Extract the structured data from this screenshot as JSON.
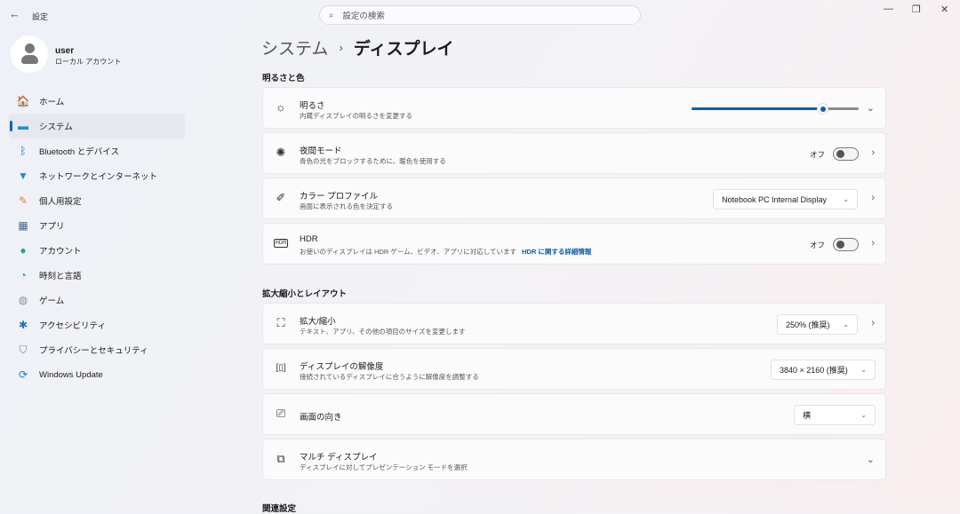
{
  "window": {
    "title": "設定",
    "back": "←",
    "minimize": "—",
    "maximize": "❐",
    "close": "✕"
  },
  "search": {
    "placeholder": "設定の検索",
    "icon": "⌕"
  },
  "user": {
    "name": "user",
    "type": "ローカル アカウント"
  },
  "nav": [
    {
      "label": "ホーム",
      "icon": "🏠",
      "color": "#e08a3c"
    },
    {
      "label": "システム",
      "icon": "▬",
      "color": "#1a8fd6"
    },
    {
      "label": "Bluetooth とデバイス",
      "icon": "ᛒ",
      "color": "#1677d2"
    },
    {
      "label": "ネットワークとインターネット",
      "icon": "▼",
      "color": "#1a8fd6"
    },
    {
      "label": "個人用設定",
      "icon": "✎",
      "color": "#d08a3c"
    },
    {
      "label": "アプリ",
      "icon": "▦",
      "color": "#4a6a8a"
    },
    {
      "label": "アカウント",
      "icon": "●",
      "color": "#2aa58a"
    },
    {
      "label": "時刻と言語",
      "icon": "◔",
      "color": "#1a8fd6"
    },
    {
      "label": "ゲーム",
      "icon": "◍",
      "color": "#8a8f98"
    },
    {
      "label": "アクセシビリティ",
      "icon": "✱",
      "color": "#1677d2"
    },
    {
      "label": "プライバシーとセキュリティ",
      "icon": "⛉",
      "color": "#7a8088"
    },
    {
      "label": "Windows Update",
      "icon": "⟳",
      "color": "#1677d2"
    }
  ],
  "breadcrumb": {
    "parent": "システム",
    "sep": "›",
    "current": "ディスプレイ"
  },
  "sections": {
    "brightness_color": "明るさと色",
    "scale_layout": "拡大縮小とレイアウト",
    "related": "関連設定"
  },
  "brightness": {
    "title": "明るさ",
    "desc": "内蔵ディスプレイの明るさを変更する",
    "value": 78,
    "icon": "☼"
  },
  "night": {
    "title": "夜間モード",
    "desc": "青色の光をブロックするために、暖色を使用する",
    "state": "オフ",
    "icon": "✺"
  },
  "profile": {
    "title": "カラー プロファイル",
    "desc": "画面に表示される色を決定する",
    "value": "Notebook PC Internal Display",
    "icon": "✐"
  },
  "hdr": {
    "title": "HDR",
    "desc": "お使いのディスプレイは HDR ゲーム、ビデオ、アプリに対応しています",
    "link": "HDR に関する詳細情報",
    "state": "オフ",
    "icon": "HDR"
  },
  "scale": {
    "title": "拡大/縮小",
    "desc": "テキスト、アプリ、その他の項目のサイズを変更します",
    "value": "250% (推奨)",
    "icon": "⛶"
  },
  "resolution": {
    "title": "ディスプレイの解像度",
    "desc": "接続されているディスプレイに合うように解像度を調整する",
    "value": "3840 × 2160 (推奨)",
    "icon": "[▯]"
  },
  "orientation": {
    "title": "画面の向き",
    "value": "横",
    "icon": "⎚"
  },
  "multi": {
    "title": "マルチ ディスプレイ",
    "desc": "ディスプレイに対してプレゼンテーション モードを選択",
    "icon": "⧉"
  },
  "glyphs": {
    "chev_right": "›",
    "chev_down": "⌄",
    "dd_arrow": "⌄"
  }
}
